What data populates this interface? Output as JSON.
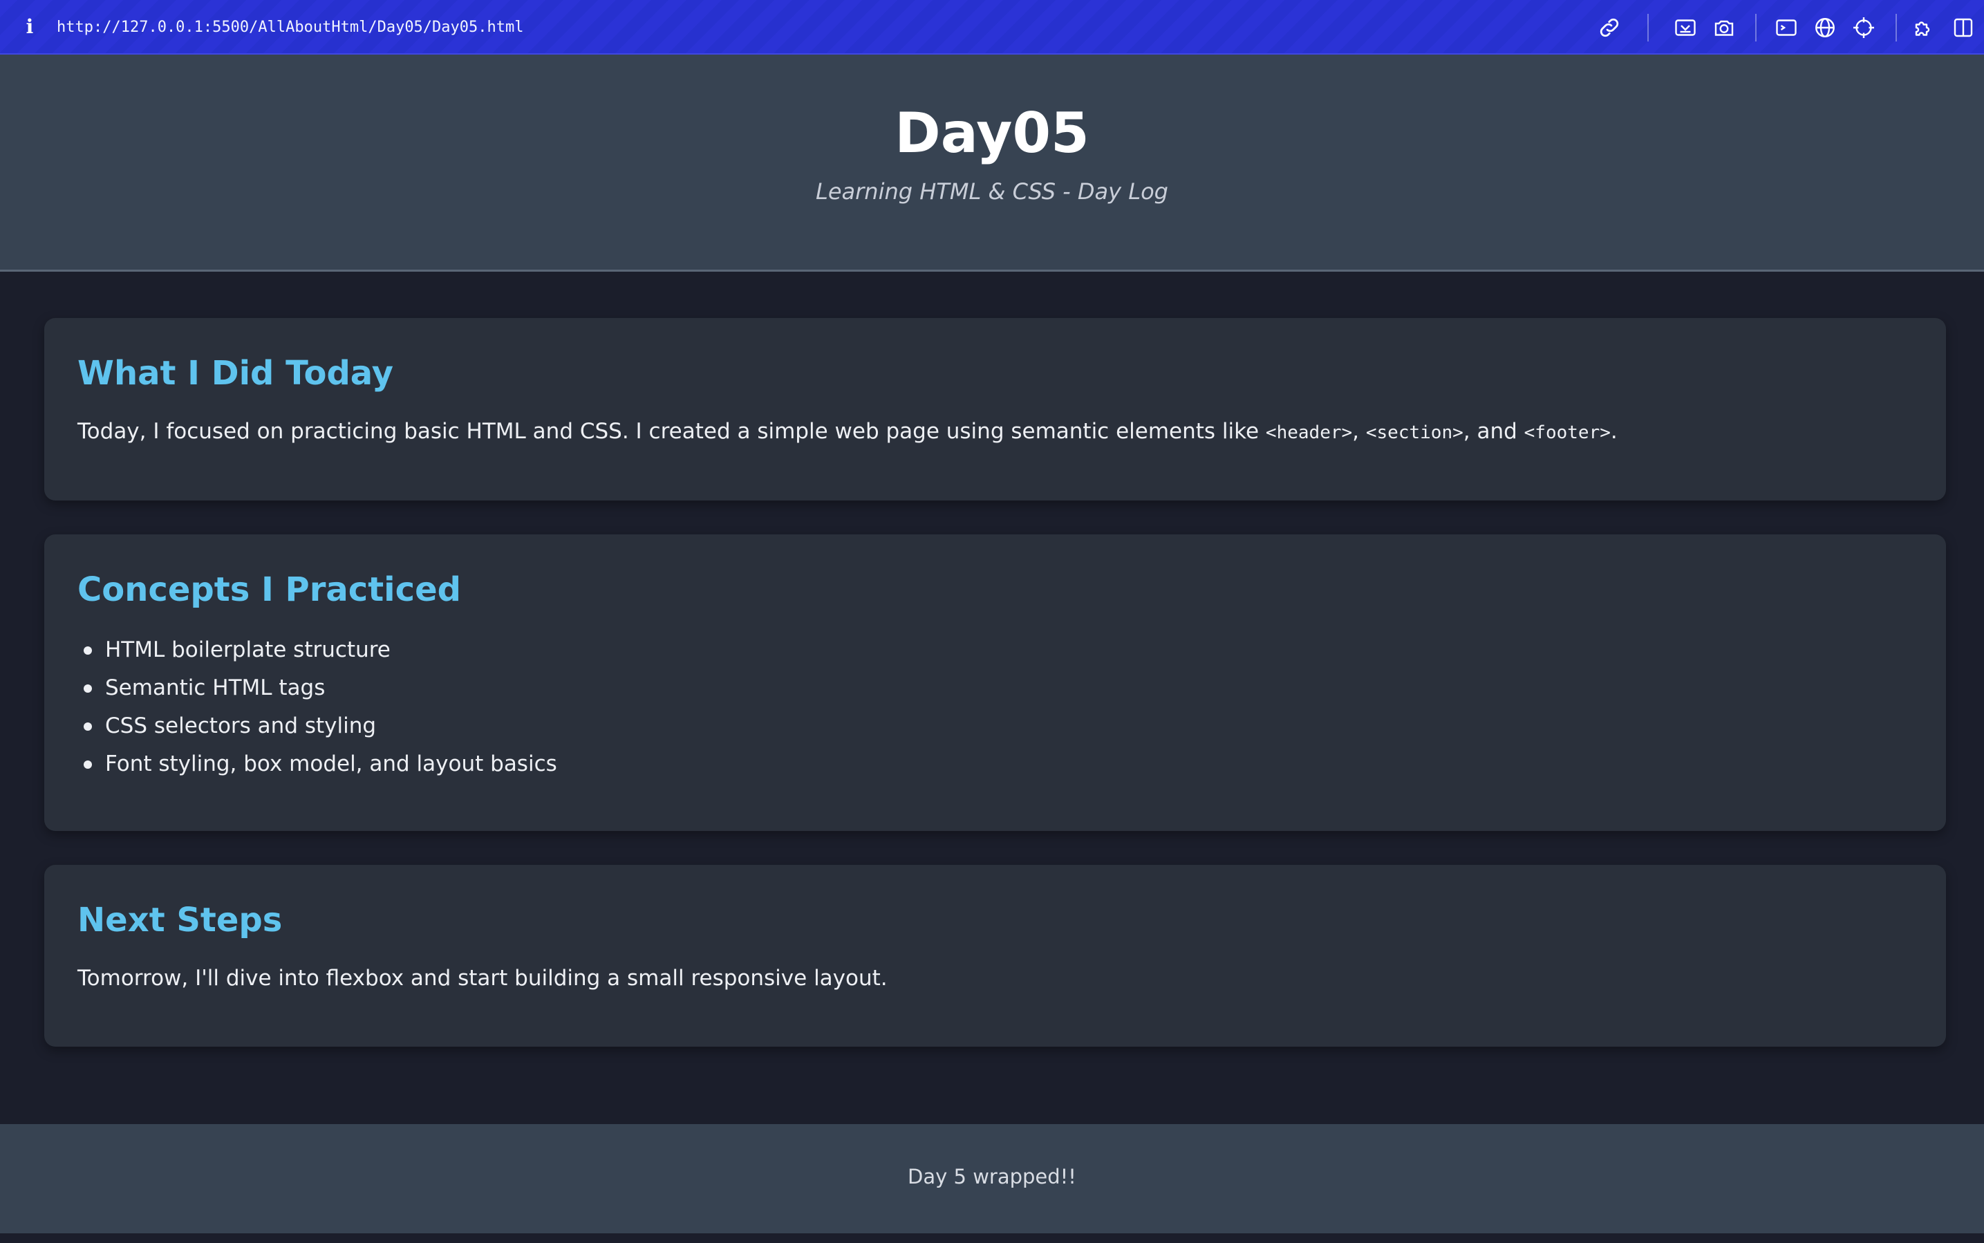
{
  "browser": {
    "info_icon": "info-icon",
    "url": "http://127.0.0.1:5500/AllAboutHtml/Day05/Day05.html",
    "toolbar_icons": [
      "link-icon",
      "screen-capture-icon",
      "camera-icon",
      "terminal-icon",
      "globe-icon",
      "crosshair-icon",
      "extensions-icon",
      "sidebar-icon"
    ],
    "accent_color": "#2b33d6"
  },
  "header": {
    "title": "Day05",
    "subtitle": "Learning HTML & CSS - Day Log"
  },
  "sections": {
    "today": {
      "heading": "What I Did Today",
      "text_before": "Today, I focused on practicing basic HTML and CSS. I created a simple web page using semantic elements like ",
      "code1": "<header>",
      "sep1": ", ",
      "code2": "<section>",
      "sep2": ", and ",
      "code3": "<footer>",
      "text_after": "."
    },
    "concepts": {
      "heading": "Concepts I Practiced",
      "items": [
        "HTML boilerplate structure",
        "Semantic HTML tags",
        "CSS selectors and styling",
        "Font styling, box model, and layout basics"
      ]
    },
    "next": {
      "heading": "Next Steps",
      "text": "Tomorrow, I'll dive into flexbox and start building a small responsive layout."
    }
  },
  "footer": {
    "text": "Day 5 wrapped!!"
  },
  "colors": {
    "page_background": "#1b1e2b",
    "header_background": "#374352",
    "card_background": "#2a303b",
    "heading_color": "#5fc3ee"
  }
}
